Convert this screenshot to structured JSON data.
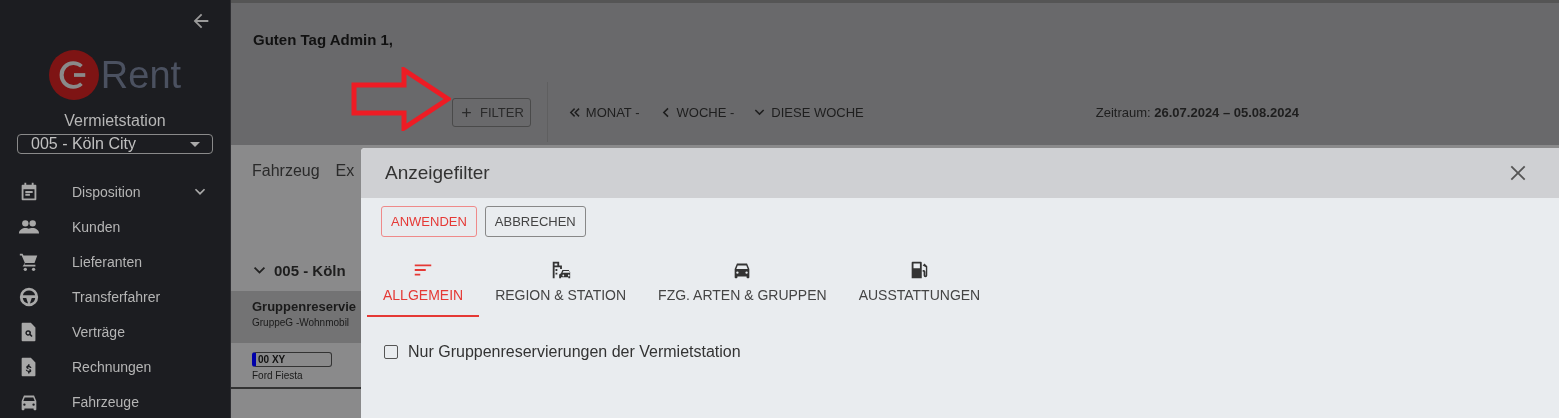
{
  "sidebar": {
    "logo_text": "Rent",
    "station_label": "Vermietstation",
    "station_select": {
      "value": "005 - Köln City"
    },
    "items": [
      {
        "label": "Disposition",
        "kind": "calendar",
        "expandable": true
      },
      {
        "label": "Kunden",
        "kind": "people",
        "expandable": false
      },
      {
        "label": "Lieferanten",
        "kind": "cart",
        "expandable": false
      },
      {
        "label": "Transferfahrer",
        "kind": "wheel",
        "expandable": false
      },
      {
        "label": "Verträge",
        "kind": "search",
        "expandable": false
      },
      {
        "label": "Rechnungen",
        "kind": "invoice",
        "expandable": false
      },
      {
        "label": "Fahrzeuge",
        "kind": "car",
        "expandable": false
      }
    ]
  },
  "header": {
    "greeting": "Guten Tag Admin 1,",
    "filter_button": "FILTER",
    "nav": [
      {
        "label": "MONAT -",
        "kind": "month"
      },
      {
        "label": "WOCHE -",
        "kind": "week"
      },
      {
        "label": "DIESE WOCHE",
        "kind": "current"
      }
    ],
    "period": "Zeitraum: **26.07.2024 – 05.08.2024**"
  },
  "background": {
    "tabs": [
      "Fahrzeug",
      "Ex"
    ],
    "group_title": "005 - Köln",
    "group_row": {
      "title": "Gruppenreservie",
      "subtitle": "GruppeG -Wohnmobil"
    },
    "vehicle": {
      "plate": "00 XY",
      "model": "Ford Fiesta",
      "color": "#0000aa"
    }
  },
  "dialog": {
    "title": "Anzeigefilter",
    "buttons": [
      {
        "label": "ANWENDEN",
        "kind": "primary"
      },
      {
        "label": "ABBRECHEN",
        "kind": "secondary"
      }
    ],
    "tabs": [
      {
        "label": "ALLGEMEIN",
        "kind": "general",
        "selected": true
      },
      {
        "label": "REGION & STATION",
        "kind": "region",
        "selected": false
      },
      {
        "label": "FZG. ARTEN & GRUPPEN",
        "kind": "vehicle",
        "selected": false
      },
      {
        "label": "AUSSTATTUNGEN",
        "kind": "equipment",
        "selected": false
      }
    ],
    "checkbox": {
      "label": "Nur Gruppenreservierungen der Vermietstation",
      "checked": false
    }
  }
}
